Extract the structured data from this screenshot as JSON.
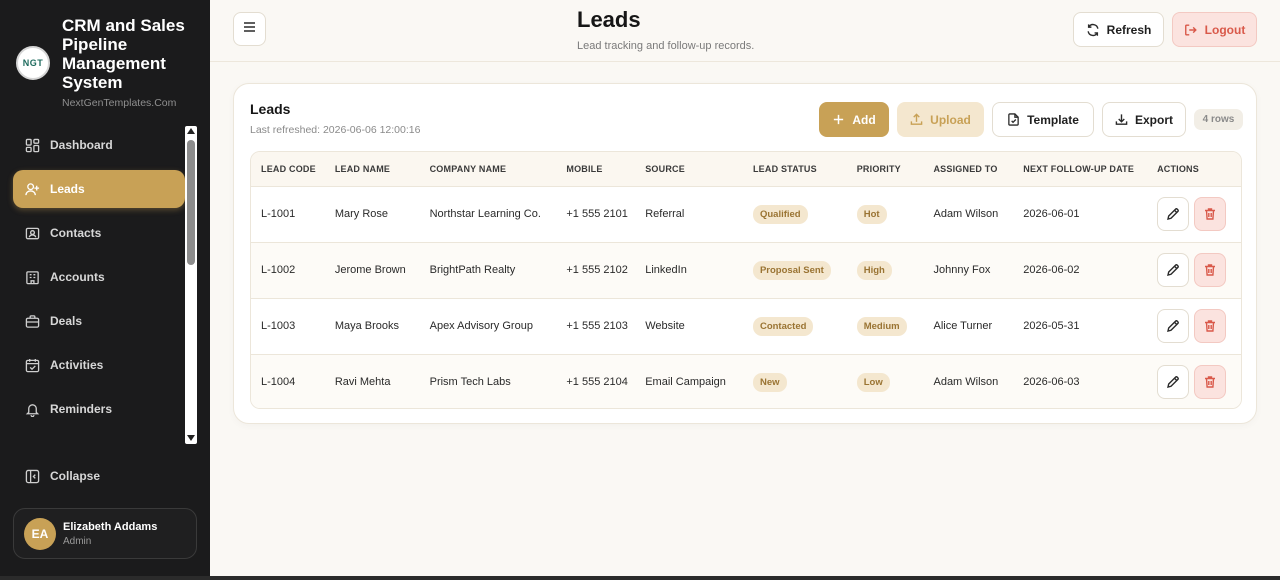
{
  "brand": {
    "logo_text": "NGT",
    "title": "CRM and Sales Pipeline Management System",
    "subtitle": "NextGenTemplates.Com"
  },
  "sidebar": {
    "items": [
      {
        "label": "Dashboard",
        "icon": "grid-icon",
        "active": false
      },
      {
        "label": "Leads",
        "icon": "user-plus-icon",
        "active": true
      },
      {
        "label": "Contacts",
        "icon": "address-card-icon",
        "active": false
      },
      {
        "label": "Accounts",
        "icon": "building-icon",
        "active": false
      },
      {
        "label": "Deals",
        "icon": "briefcase-icon",
        "active": false
      },
      {
        "label": "Activities",
        "icon": "calendar-check-icon",
        "active": false
      },
      {
        "label": "Reminders",
        "icon": "bell-icon",
        "active": false
      }
    ],
    "collapse_label": "Collapse",
    "user": {
      "initials": "EA",
      "name": "Elizabeth Addams",
      "role": "Admin"
    }
  },
  "header": {
    "title": "Leads",
    "subtitle": "Lead tracking and follow-up records.",
    "refresh_label": "Refresh",
    "logout_label": "Logout"
  },
  "panel": {
    "title": "Leads",
    "last_refreshed": "Last refreshed: 2026-06-06 12:00:16",
    "add_label": "Add",
    "upload_label": "Upload",
    "template_label": "Template",
    "export_label": "Export",
    "rows_badge": "4 rows"
  },
  "table": {
    "columns": [
      "LEAD CODE",
      "LEAD NAME",
      "COMPANY NAME",
      "MOBILE",
      "SOURCE",
      "LEAD STATUS",
      "PRIORITY",
      "ASSIGNED TO",
      "NEXT FOLLOW-UP DATE",
      "ACTIONS"
    ],
    "rows": [
      {
        "code": "L-1001",
        "name": "Mary Rose",
        "company": "Northstar Learning Co.",
        "mobile": "+1 555 2101",
        "source": "Referral",
        "status": "Qualified",
        "priority": "Hot",
        "assigned": "Adam Wilson",
        "followup": "2026-06-01"
      },
      {
        "code": "L-1002",
        "name": "Jerome Brown",
        "company": "BrightPath Realty",
        "mobile": "+1 555 2102",
        "source": "LinkedIn",
        "status": "Proposal Sent",
        "priority": "High",
        "assigned": "Johnny Fox",
        "followup": "2026-06-02"
      },
      {
        "code": "L-1003",
        "name": "Maya Brooks",
        "company": "Apex Advisory Group",
        "mobile": "+1 555 2103",
        "source": "Website",
        "status": "Contacted",
        "priority": "Medium",
        "assigned": "Alice Turner",
        "followup": "2026-05-31"
      },
      {
        "code": "L-1004",
        "name": "Ravi Mehta",
        "company": "Prism Tech Labs",
        "mobile": "+1 555 2104",
        "source": "Email Campaign",
        "status": "New",
        "priority": "Low",
        "assigned": "Adam Wilson",
        "followup": "2026-06-03"
      }
    ]
  },
  "colors": {
    "accent": "#c8a156",
    "sidebar_bg": "#1b1b1c",
    "danger": "#d9594a",
    "danger_bg": "#fbe3df"
  }
}
